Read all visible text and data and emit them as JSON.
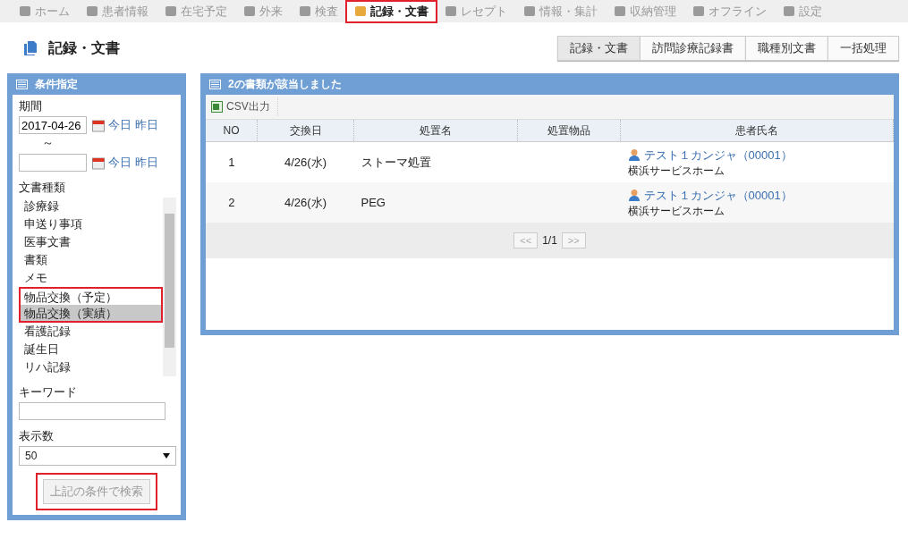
{
  "nav": [
    {
      "label": "ホーム",
      "selected": false,
      "highlighted": false
    },
    {
      "label": "患者情報",
      "selected": false,
      "highlighted": false
    },
    {
      "label": "在宅予定",
      "selected": false,
      "highlighted": false
    },
    {
      "label": "外来",
      "selected": false,
      "highlighted": false
    },
    {
      "label": "検査",
      "selected": false,
      "highlighted": false
    },
    {
      "label": "記録・文書",
      "selected": true,
      "highlighted": true
    },
    {
      "label": "レセプト",
      "selected": false,
      "highlighted": false
    },
    {
      "label": "情報・集計",
      "selected": false,
      "highlighted": false
    },
    {
      "label": "収納管理",
      "selected": false,
      "highlighted": false
    },
    {
      "label": "オフライン",
      "selected": false,
      "highlighted": false
    },
    {
      "label": "設定",
      "selected": false,
      "highlighted": false
    }
  ],
  "page_title": "記録・文書",
  "view_tabs": [
    {
      "label": "記録・文書",
      "selected": true
    },
    {
      "label": "訪問診療記録書",
      "selected": false
    },
    {
      "label": "職種別文書",
      "selected": false
    },
    {
      "label": "一括処理",
      "selected": false
    }
  ],
  "filter": {
    "title": "条件指定",
    "period_label": "期間",
    "date_from": {
      "value": "2017-04-26",
      "today": "今日",
      "yesterday": "昨日"
    },
    "separator": "～",
    "date_to": {
      "today": "今日",
      "yesterday": "昨日"
    },
    "doc_type_label": "文書種類",
    "doc_types": [
      {
        "label": "診療録",
        "selected": false,
        "highlighted": false
      },
      {
        "label": "申送り事項",
        "selected": false,
        "highlighted": false
      },
      {
        "label": "医事文書",
        "selected": false,
        "highlighted": false
      },
      {
        "label": "書類",
        "selected": false,
        "highlighted": false
      },
      {
        "label": "メモ",
        "selected": false,
        "highlighted": false
      },
      {
        "label": "物品交換（予定）",
        "selected": false,
        "highlighted": true
      },
      {
        "label": "物品交換（実績）",
        "selected": true,
        "highlighted": true
      },
      {
        "label": "看護記録",
        "selected": false,
        "highlighted": false
      },
      {
        "label": "誕生日",
        "selected": false,
        "highlighted": false
      },
      {
        "label": "リハ記録",
        "selected": false,
        "highlighted": false
      }
    ],
    "keyword_label": "キーワード",
    "count_label": "表示数",
    "count_value": "50",
    "search_button": {
      "label": "上記の条件で検索",
      "highlighted": true
    }
  },
  "results": {
    "title": "2の書類が該当しました",
    "csv_button": "CSV出力",
    "columns": [
      "NO",
      "交換日",
      "処置名",
      "処置物品",
      "患者氏名"
    ],
    "rows": [
      {
        "no": "1",
        "date": "4/26(水)",
        "treatment": "ストーマ処置",
        "patient": "テスト１カンジャ（00001）",
        "facility": "横浜サービスホーム"
      },
      {
        "no": "2",
        "date": "4/26(水)",
        "treatment": "PEG",
        "patient": "テスト１カンジャ（00001）",
        "facility": "横浜サービスホーム"
      }
    ],
    "pager": {
      "prev": "<<",
      "page": "1/1",
      "next": ">>"
    }
  }
}
